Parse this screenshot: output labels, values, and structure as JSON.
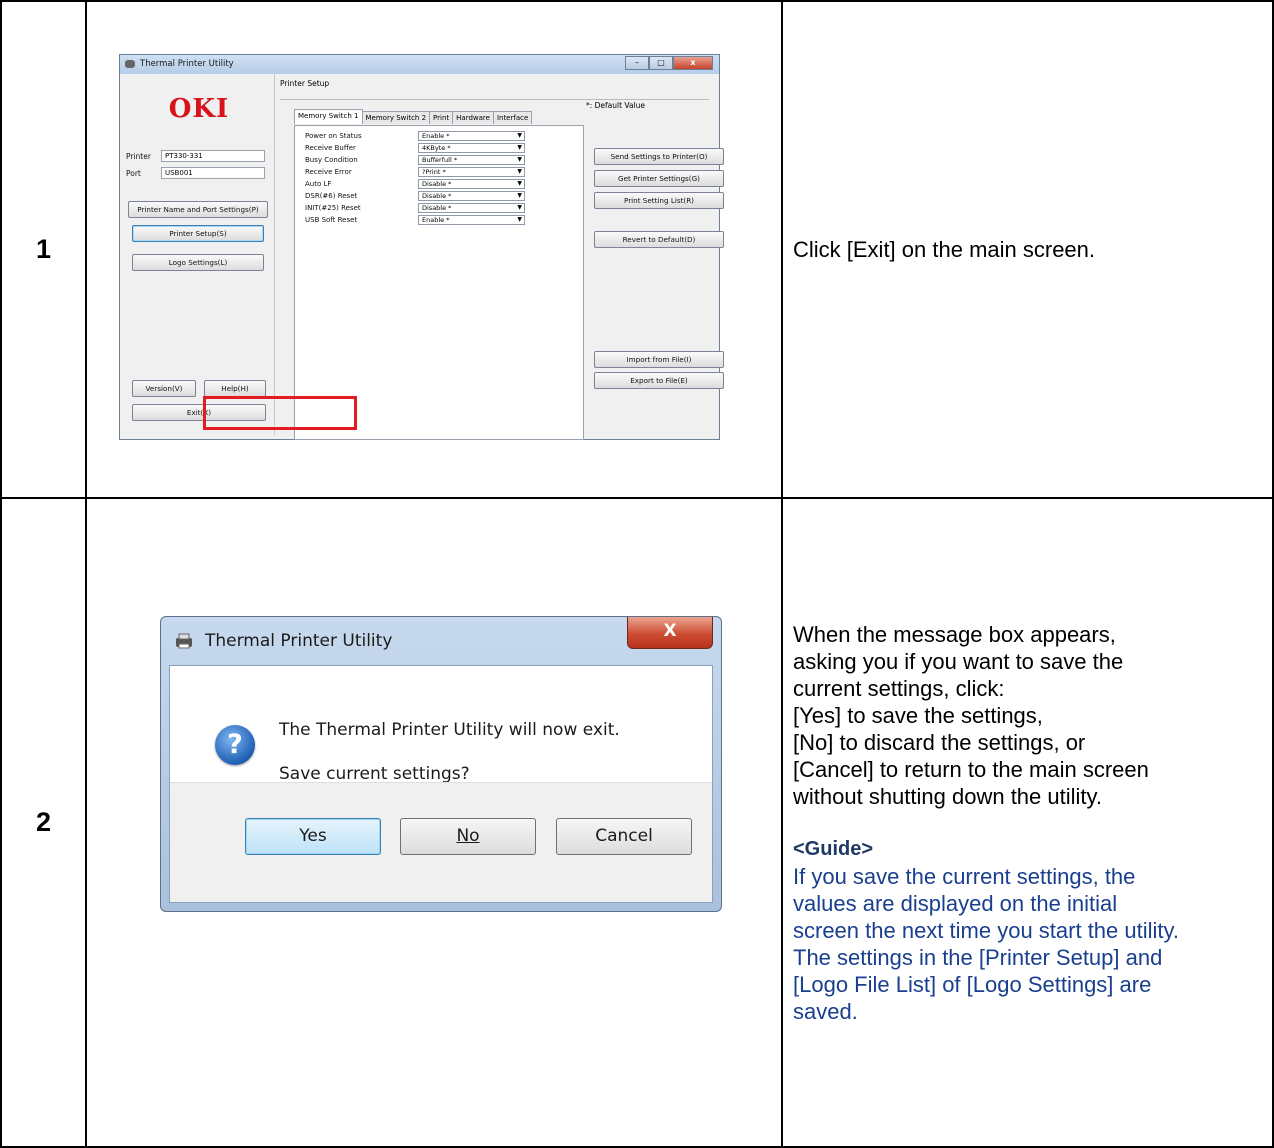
{
  "steps": [
    {
      "number": "1",
      "text": "Click [Exit] on the main screen."
    },
    {
      "number": "2",
      "lines": [
        "When the message box appears,",
        "asking you if you want to save the",
        "current settings, click:",
        "[Yes] to save the settings,",
        "[No] to discard the settings, or",
        "[Cancel] to return to the main screen",
        "without shutting down the utility."
      ],
      "guide_heading": "<Guide>",
      "guide_lines": [
        "If you save the current settings, the",
        "values are displayed on the initial",
        "screen the next time you start the utility.",
        "The settings in the [Printer Setup] and",
        "[Logo File List] of [Logo Settings] are",
        "saved."
      ]
    }
  ],
  "window": {
    "title": "Thermal Printer Utility",
    "logo": "OKI",
    "printer_label": "Printer",
    "printer_value": "PT330-331",
    "port_label": "Port",
    "port_value": "USB001",
    "left_buttons": {
      "name_port": "Printer Name and Port Settings(P)",
      "printer_setup": "Printer Setup(S)",
      "logo_settings": "Logo Settings(L)",
      "version": "Version(V)",
      "help": "Help(H)",
      "exit": "Exit(X)"
    },
    "group_title": "Printer Setup",
    "default_value_note": "*: Default Value",
    "tabs": [
      "Memory Switch 1",
      "Memory Switch 2",
      "Print",
      "Hardware",
      "Interface"
    ],
    "settings": [
      {
        "label": "Power on Status",
        "value": "Enable *"
      },
      {
        "label": "Receive Buffer",
        "value": "4KByte *"
      },
      {
        "label": "Busy Condition",
        "value": "Bufferfull *"
      },
      {
        "label": "Receive Error",
        "value": "?Print *"
      },
      {
        "label": "Auto LF",
        "value": "Disable *"
      },
      {
        "label": "DSR(#6) Reset",
        "value": "Disable *"
      },
      {
        "label": "INIT(#25) Reset",
        "value": "Disable *"
      },
      {
        "label": "USB Soft Reset",
        "value": "Enable *"
      }
    ],
    "right_buttons": {
      "send": "Send Settings to Printer(O)",
      "get": "Get Printer Settings(G)",
      "list": "Print Setting List(R)",
      "revert": "Revert to Default(D)",
      "import": "Import from File(I)",
      "export": "Export to File(E)"
    }
  },
  "dialog": {
    "title": "Thermal Printer Utility",
    "close_glyph": "X",
    "message1": "The Thermal Printer Utility will now exit.",
    "message2": "Save current settings?",
    "yes": "Yes",
    "no": "No",
    "cancel": "Cancel"
  },
  "colors": {
    "oki_red": "#d8121a",
    "highlight_red": "#e31c24",
    "guide_blue": "#1a3f8f"
  }
}
